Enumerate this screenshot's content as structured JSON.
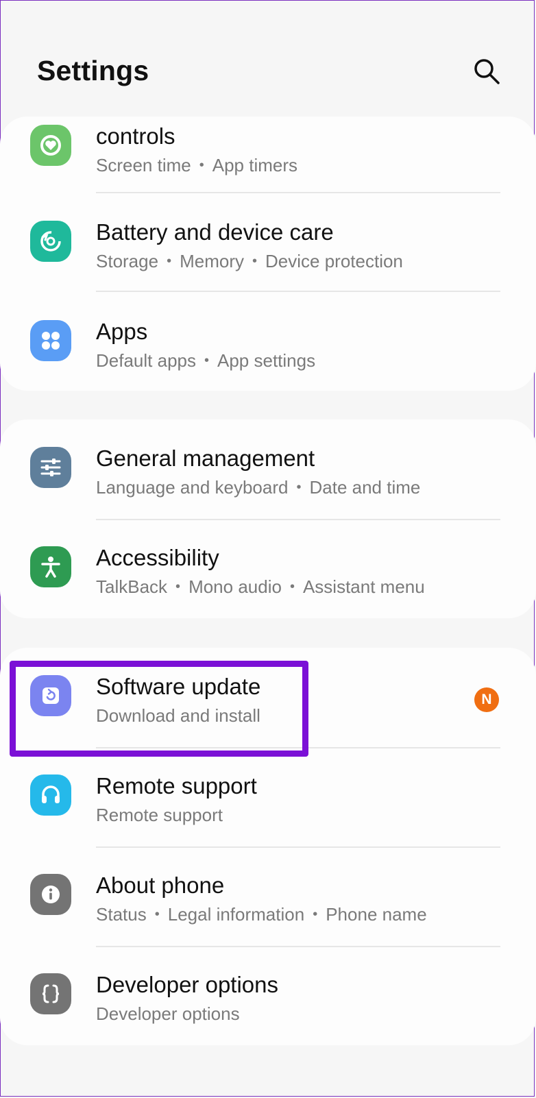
{
  "header": {
    "title": "Settings",
    "search_icon": "search-icon"
  },
  "group1": {
    "items": [
      {
        "label": "controls",
        "sub": [
          "Screen time",
          "App timers"
        ],
        "icon": "heart-ring-icon",
        "color": "#6cc56a"
      },
      {
        "label": "Battery and device care",
        "sub": [
          "Storage",
          "Memory",
          "Device protection"
        ],
        "icon": "device-care-icon",
        "color": "#1fb99b"
      },
      {
        "label": "Apps",
        "sub": [
          "Default apps",
          "App settings"
        ],
        "icon": "apps-grid-icon",
        "color": "#5a9df5"
      }
    ]
  },
  "group2": {
    "items": [
      {
        "label": "General management",
        "sub": [
          "Language and keyboard",
          "Date and time"
        ],
        "icon": "sliders-icon",
        "color": "#5f7f9b"
      },
      {
        "label": "Accessibility",
        "sub": [
          "TalkBack",
          "Mono audio",
          "Assistant menu"
        ],
        "icon": "accessibility-icon",
        "color": "#2e9b52"
      }
    ]
  },
  "group3": {
    "items": [
      {
        "label": "Software update",
        "sub": [
          "Download and install"
        ],
        "icon": "software-update-icon",
        "color": "#7b84f0",
        "badge": "N",
        "badge_color": "#f06e12"
      },
      {
        "label": "Remote support",
        "sub": [
          "Remote support"
        ],
        "icon": "headset-icon",
        "color": "#25b9ea"
      },
      {
        "label": "About phone",
        "sub": [
          "Status",
          "Legal information",
          "Phone name"
        ],
        "icon": "info-icon",
        "color": "#747474"
      },
      {
        "label": "Developer options",
        "sub": [
          "Developer options"
        ],
        "icon": "braces-icon",
        "color": "#747474"
      }
    ]
  },
  "highlight_color": "#7b10d6",
  "subtitle_separator": "•"
}
